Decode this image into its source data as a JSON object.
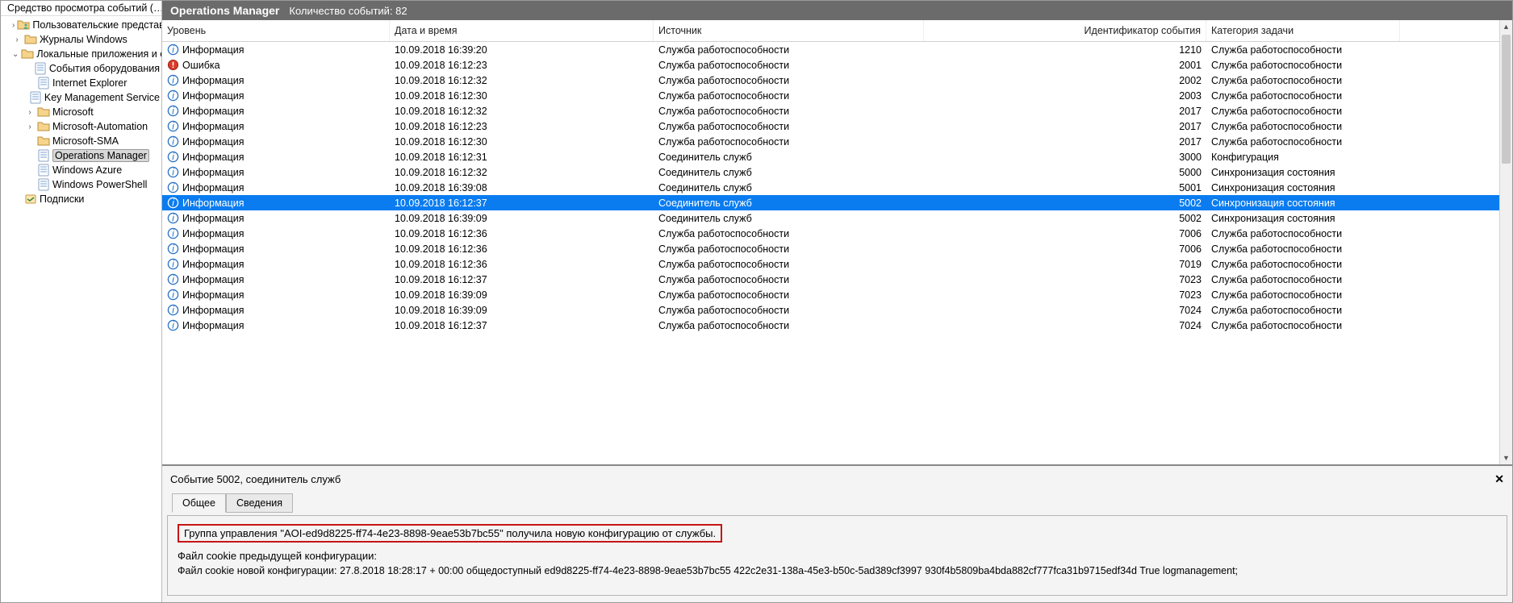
{
  "sidebar": {
    "title": "Средство просмотра событий (…",
    "nodes": [
      {
        "depth": 1,
        "twisty": "›",
        "icon": "folder-user",
        "label": "Пользовательские представ…"
      },
      {
        "depth": 1,
        "twisty": "›",
        "icon": "folder",
        "label": "Журналы Windows"
      },
      {
        "depth": 1,
        "twisty": "⌄",
        "icon": "folder",
        "label": "Локальные приложения и с…"
      },
      {
        "depth": 2,
        "twisty": "",
        "icon": "log",
        "label": "События оборудования"
      },
      {
        "depth": 2,
        "twisty": "",
        "icon": "log",
        "label": "Internet Explorer"
      },
      {
        "depth": 2,
        "twisty": "",
        "icon": "log",
        "label": "Key Management Service"
      },
      {
        "depth": 2,
        "twisty": "›",
        "icon": "folder",
        "label": "Microsoft"
      },
      {
        "depth": 2,
        "twisty": "›",
        "icon": "folder",
        "label": "Microsoft-Automation"
      },
      {
        "depth": 2,
        "twisty": "",
        "icon": "folder",
        "label": "Microsoft-SMA"
      },
      {
        "depth": 2,
        "twisty": "",
        "icon": "log",
        "label": "Operations Manager",
        "selected": true
      },
      {
        "depth": 2,
        "twisty": "",
        "icon": "log",
        "label": "Windows Azure"
      },
      {
        "depth": 2,
        "twisty": "",
        "icon": "log",
        "label": "Windows PowerShell"
      },
      {
        "depth": 1,
        "twisty": "",
        "icon": "sub",
        "label": "Подписки"
      }
    ]
  },
  "header": {
    "title": "Operations Manager",
    "event_count_label": "Количество событий: 82"
  },
  "columns": {
    "level": "Уровень",
    "datetime": "Дата и время",
    "source": "Источник",
    "event_id": "Идентификатор события",
    "task_cat": "Категория задачи"
  },
  "events": [
    {
      "level": "Информация",
      "lv": "info",
      "dt": "10.09.2018 16:39:20",
      "src": "Служба работоспособности",
      "id": 1210,
      "cat": "Служба работоспособности"
    },
    {
      "level": "Ошибка",
      "lv": "error",
      "dt": "10.09.2018 16:12:23",
      "src": "Служба работоспособности",
      "id": 2001,
      "cat": "Служба работоспособности"
    },
    {
      "level": "Информация",
      "lv": "info",
      "dt": "10.09.2018 16:12:32",
      "src": "Служба работоспособности",
      "id": 2002,
      "cat": "Служба работоспособности"
    },
    {
      "level": "Информация",
      "lv": "info",
      "dt": "10.09.2018 16:12:30",
      "src": "Служба работоспособности",
      "id": 2003,
      "cat": "Служба работоспособности"
    },
    {
      "level": "Информация",
      "lv": "info",
      "dt": "10.09.2018 16:12:32",
      "src": "Служба работоспособности",
      "id": 2017,
      "cat": "Служба работоспособности"
    },
    {
      "level": "Информация",
      "lv": "info",
      "dt": "10.09.2018 16:12:23",
      "src": "Служба работоспособности",
      "id": 2017,
      "cat": "Служба работоспособности"
    },
    {
      "level": "Информация",
      "lv": "info",
      "dt": "10.09.2018 16:12:30",
      "src": "Служба работоспособности",
      "id": 2017,
      "cat": "Служба работоспособности"
    },
    {
      "level": "Информация",
      "lv": "info",
      "dt": "10.09.2018 16:12:31",
      "src": "Соединитель служб",
      "id": 3000,
      "cat": "Конфигурация"
    },
    {
      "level": "Информация",
      "lv": "info",
      "dt": "10.09.2018 16:12:32",
      "src": "Соединитель служб",
      "id": 5000,
      "cat": "Синхронизация состояния"
    },
    {
      "level": "Информация",
      "lv": "info",
      "dt": "10.09.2018 16:39:08",
      "src": "Соединитель служб",
      "id": 5001,
      "cat": "Синхронизация состояния"
    },
    {
      "level": "Информация",
      "lv": "info",
      "dt": "10.09.2018 16:12:37",
      "src": "Соединитель служб",
      "id": 5002,
      "cat": "Синхронизация состояния",
      "selected": true
    },
    {
      "level": "Информация",
      "lv": "info",
      "dt": "10.09.2018 16:39:09",
      "src": "Соединитель служб",
      "id": 5002,
      "cat": "Синхронизация состояния"
    },
    {
      "level": "Информация",
      "lv": "info",
      "dt": "10.09.2018 16:12:36",
      "src": "Служба работоспособности",
      "id": 7006,
      "cat": "Служба работоспособности"
    },
    {
      "level": "Информация",
      "lv": "info",
      "dt": "10.09.2018 16:12:36",
      "src": "Служба работоспособности",
      "id": 7006,
      "cat": "Служба работоспособности"
    },
    {
      "level": "Информация",
      "lv": "info",
      "dt": "10.09.2018 16:12:36",
      "src": "Служба работоспособности",
      "id": 7019,
      "cat": "Служба работоспособности"
    },
    {
      "level": "Информация",
      "lv": "info",
      "dt": "10.09.2018 16:12:37",
      "src": "Служба работоспособности",
      "id": 7023,
      "cat": "Служба работоспособности"
    },
    {
      "level": "Информация",
      "lv": "info",
      "dt": "10.09.2018 16:39:09",
      "src": "Служба работоспособности",
      "id": 7023,
      "cat": "Служба работоспособности"
    },
    {
      "level": "Информация",
      "lv": "info",
      "dt": "10.09.2018 16:39:09",
      "src": "Служба работоспособности",
      "id": 7024,
      "cat": "Служба работоспособности"
    },
    {
      "level": "Информация",
      "lv": "info",
      "dt": "10.09.2018 16:12:37",
      "src": "Служба работоспособности",
      "id": 7024,
      "cat": "Служба работоспособности"
    }
  ],
  "details": {
    "title": "Событие 5002, соединитель служб",
    "tabs": {
      "general": "Общее",
      "details": "Сведения"
    },
    "highlight": "Группа управления \"AOI-ed9d8225-ff74-4e23-8898-9eae53b7bc55\" получила новую конфигурацию от службы.",
    "prev_cookie_label": "Файл cookie предыдущей конфигурации:",
    "new_cookie_label": "Файл cookie новой конфигурации:",
    "new_cookie_value": "27.8.2018 18:28:17 + 00:00 общедоступный ed9d8225-ff74-4e23-8898-9eae53b7bc55 422c2e31-138a-45e3-b50c-5ad389cf3997 930f4b5809ba4bda882cf777fca31b9715edf34d True logmanagement;"
  }
}
